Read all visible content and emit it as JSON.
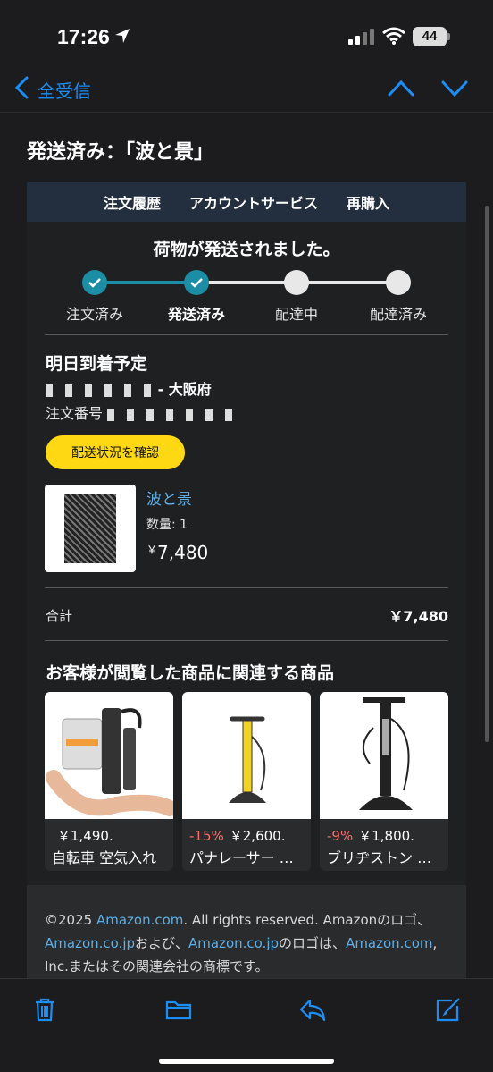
{
  "status_bar": {
    "time": "17:26",
    "battery": "44"
  },
  "nav": {
    "back_label": "全受信"
  },
  "email": {
    "subject": "発送済み：「波と景」",
    "menu": [
      "注文履歴",
      "アカウントサービス",
      "再購入"
    ],
    "shipped_title": "荷物が発送されました。",
    "steps": [
      {
        "label": "注文済み",
        "done": true
      },
      {
        "label": "発送済み",
        "done": true
      },
      {
        "label": "配達中",
        "done": false
      },
      {
        "label": "配達済み",
        "done": false
      }
    ],
    "arrival": "明日到着予定",
    "address_suffix": "- 大阪府",
    "order_label": "注文番号",
    "track_button": "配送状況を確認",
    "product": {
      "name": "波と景",
      "qty": "数量: 1",
      "price_symbol": "￥",
      "price": "7,480"
    },
    "total_label": "合計",
    "total_value": "￥7,480",
    "recommend_title": "お客様が閲覧した商品に関連する商品",
    "recommendations": [
      {
        "discount": "",
        "price": "￥1,490.",
        "name": "自転車 空気入れ"
      },
      {
        "discount": "-15%",
        "price": "￥2,600.",
        "name": "パナレーサー 空気入れ"
      },
      {
        "discount": "-9%",
        "price": "￥1,800.",
        "name": "ブリヂストン 空気入れ"
      }
    ],
    "footer": {
      "copyright": "©2025 ",
      "link1": "Amazon.com",
      "text1": ". All rights reserved. Amazonのロゴ、",
      "link2": "Amazon.co.jp",
      "text2": "および、",
      "link3": "Amazon.co.jp",
      "text3": "のロゴは、",
      "link4": "Amazon.com",
      "text4": ", Inc.またはその関連会社の商標です。"
    }
  },
  "colors": {
    "accent": "#1a8ef5",
    "progress": "#1b8ea6",
    "button": "#ffd814",
    "link": "#5fb0e6",
    "discount": "#ff6b6b"
  },
  "toolbar": [
    "trash-icon",
    "folder-icon",
    "reply-icon",
    "compose-icon"
  ]
}
